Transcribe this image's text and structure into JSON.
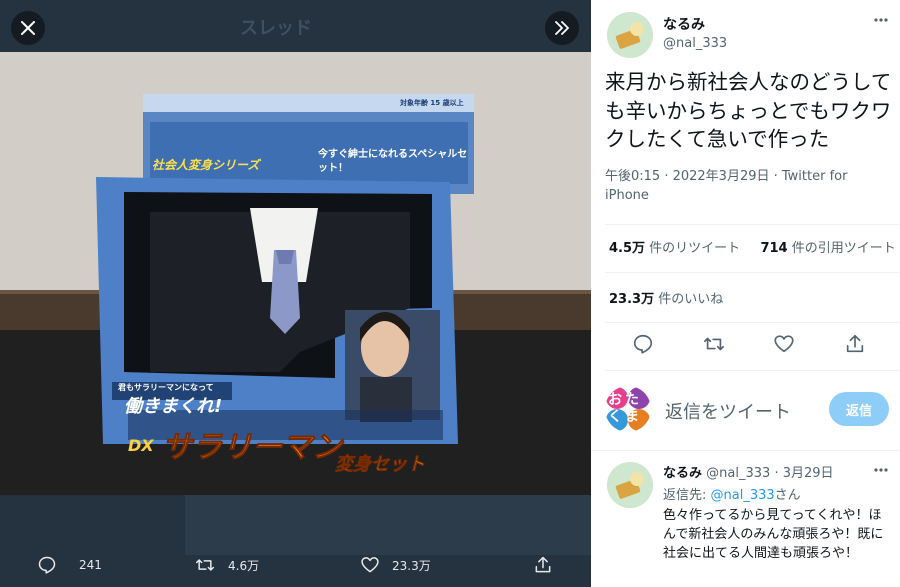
{
  "viewer": {
    "header_ghost_title": "スレッド",
    "actions": {
      "replies": "241",
      "retweets": "4.6万",
      "likes": "23.3万"
    }
  },
  "tweet": {
    "author_name": "なるみ",
    "author_handle": "@nal_333",
    "text": "来月から新社会人なのどうしても辛いからちょっとでもワクワクしたくて急いで作った",
    "meta": "午後0:15 · 2022年3月29日 · Twitter for iPhone",
    "retweets_count": "4.5万",
    "retweets_label": " 件のリツイート",
    "quotes_count": "714",
    "quotes_label": " 件の引用ツイート",
    "likes_count": "23.3万",
    "likes_label": " 件のいいね"
  },
  "reply_box": {
    "avatar_text": "おたくま",
    "placeholder": "返信をツイート",
    "button_label": "返信"
  },
  "reply": {
    "author_name": "なるみ",
    "author_handle": "@nal_333",
    "date": "· 3月29日",
    "reply_to_label": "返信先: ",
    "reply_to_mention": "@nal_333",
    "reply_to_suffix": "さん",
    "text": "色々作ってるから見てってくれや！ほんで新社会人のみんな頑張ろや！既に社会に出てる人間達も頑張ろや！"
  },
  "photo": {
    "box_top_age": "対象年齢 15 歳以上",
    "box_series": "社会人変身シリーズ",
    "box_tagline": "今すぐ紳士になれるスペシャルセット！",
    "box_catch": "働きまくれ!",
    "box_catch_small": "君もサラリーマンになって",
    "box_title_dx": "DX",
    "box_title_main": "サラリーマン",
    "box_title_sub": "変身セット"
  },
  "colors": {
    "viewer_bg": "#2b3a49",
    "link": "#1d9bf0",
    "reply_button": "#8ecdf8"
  }
}
